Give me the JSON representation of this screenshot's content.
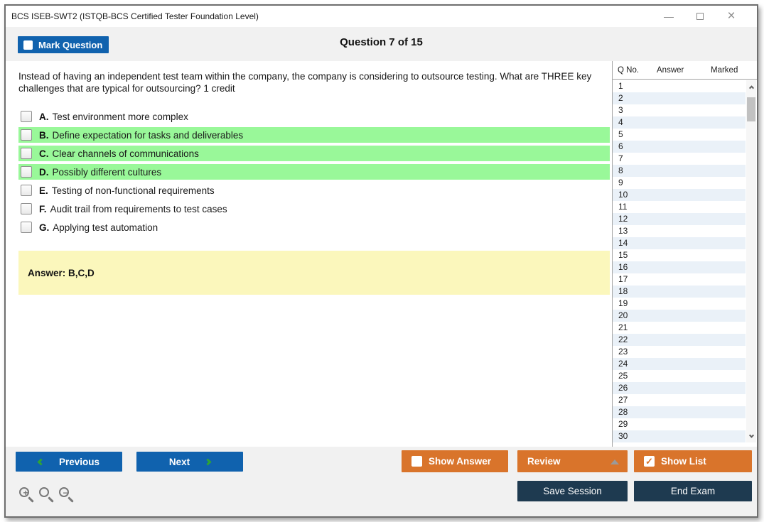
{
  "window": {
    "title": "BCS ISEB-SWT2 (ISTQB-BCS Certified Tester Foundation Level)",
    "minimize_glyph": "—",
    "close_glyph": "×"
  },
  "toolbar": {
    "mark_question_label": "Mark Question",
    "question_counter": "Question 7 of 15"
  },
  "question": {
    "text": "Instead of having an independent test team within the company, the company is considering to outsource testing. What are THREE key challenges that are typical for outsourcing? 1 credit",
    "options": [
      {
        "letter": "A.",
        "text": "Test environment more complex",
        "highlighted": false
      },
      {
        "letter": "B.",
        "text": "Define expectation for tasks and deliverables",
        "highlighted": true
      },
      {
        "letter": "C.",
        "text": "Clear channels of communications",
        "highlighted": true
      },
      {
        "letter": "D.",
        "text": "Possibly different cultures",
        "highlighted": true
      },
      {
        "letter": "E.",
        "text": "Testing of non-functional requirements",
        "highlighted": false
      },
      {
        "letter": "F.",
        "text": "Audit trail from requirements to test cases",
        "highlighted": false
      },
      {
        "letter": "G.",
        "text": "Applying test automation",
        "highlighted": false
      }
    ],
    "answer_label": "Answer: B,C,D"
  },
  "sidebar": {
    "columns": [
      "Q No.",
      "Answer",
      "Marked"
    ],
    "rows": [
      "1",
      "2",
      "3",
      "4",
      "5",
      "6",
      "7",
      "8",
      "9",
      "10",
      "11",
      "12",
      "13",
      "14",
      "15",
      "16",
      "17",
      "18",
      "19",
      "20",
      "21",
      "22",
      "23",
      "24",
      "25",
      "26",
      "27",
      "28",
      "29",
      "30"
    ]
  },
  "footer": {
    "previous_label": "Previous",
    "next_label": "Next",
    "show_answer_label": "Show Answer",
    "review_label": "Review",
    "show_list_label": "Show List",
    "save_session_label": "Save Session",
    "end_exam_label": "End Exam",
    "show_list_check": "✓",
    "icons": [
      "zoom-in-icon",
      "zoom-icon",
      "zoom-out-icon"
    ],
    "zoom_in_sign": "+",
    "zoom_out_sign": "−"
  },
  "colors": {
    "primary_blue": "#1062AE",
    "accent_orange": "#D9742B",
    "dark_navy": "#1E3A50",
    "highlight_green": "#99F899",
    "answer_yellow": "#FBF7BC",
    "row_alt_blue": "#EAF1F8",
    "chevron_green": "#2FA435"
  }
}
